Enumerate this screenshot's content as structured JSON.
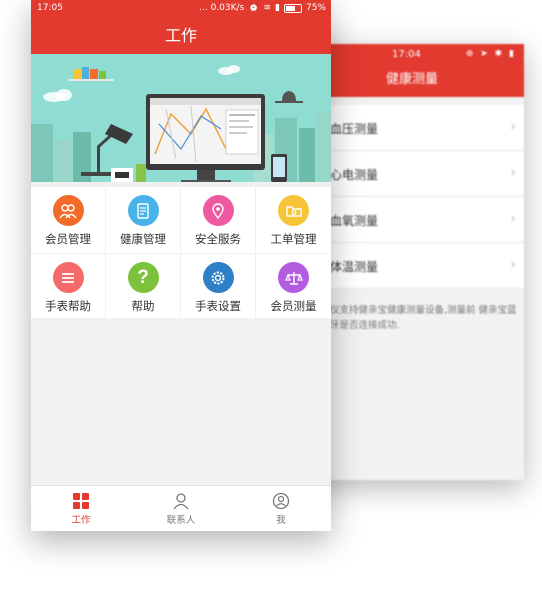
{
  "back_phone": {
    "status_time": "17:04",
    "title": "健康测量",
    "items": [
      {
        "label": "血压测量"
      },
      {
        "label": "心电测量"
      },
      {
        "label": "血氧测量"
      },
      {
        "label": "体温测量"
      }
    ],
    "note": "仪支持健亲宝健康测量设备,测量前 健亲宝蓝牙是否连接成功."
  },
  "status_bar": {
    "time": "17:05",
    "speed": "... 0.03K/s",
    "battery": "75%",
    "battery_level": 0.75
  },
  "header": {
    "title": "工作"
  },
  "menu": [
    {
      "label": "会员管理",
      "icon": "members-icon",
      "color": "#f26b2a"
    },
    {
      "label": "健康管理",
      "icon": "health-doc-icon",
      "color": "#47b3e8"
    },
    {
      "label": "安全服务",
      "icon": "location-pin-icon",
      "color": "#ee5a9f"
    },
    {
      "label": "工单管理",
      "icon": "folder-icon",
      "color": "#f7c437"
    },
    {
      "label": "手表帮助",
      "icon": "list-icon",
      "color": "#f56a6a"
    },
    {
      "label": "帮助",
      "icon": "question-icon",
      "color": "#7cc23d"
    },
    {
      "label": "手表设置",
      "icon": "settings-gear-icon",
      "color": "#2d7fc6"
    },
    {
      "label": "会员测量",
      "icon": "scale-icon",
      "color": "#b25ce0"
    }
  ],
  "tabs": [
    {
      "label": "工作",
      "icon": "grid-icon",
      "active": true
    },
    {
      "label": "联系人",
      "icon": "contacts-icon",
      "active": false
    },
    {
      "label": "我",
      "icon": "profile-icon",
      "active": false
    }
  ],
  "colors": {
    "brand": "#e23a2f",
    "tab_inactive": "#777777"
  }
}
